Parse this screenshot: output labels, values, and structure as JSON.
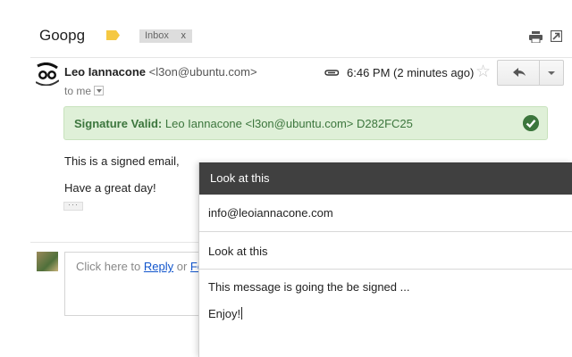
{
  "thread": {
    "subject": "Goopg",
    "label_chip": "Inbox",
    "label_chip_remove": "x"
  },
  "message": {
    "sender_name": "Leo Iannacone",
    "sender_email": "<l3on@ubuntu.com>",
    "recipient_line": "to me",
    "time": "6:46 PM (2 minutes ago)"
  },
  "signature": {
    "label": "Signature Valid:",
    "details": " Leo Iannacone <l3on@ubuntu.com> D282FC25",
    "status_color": "#3c763d",
    "background_color": "#dff0d8"
  },
  "body": {
    "line1": "This is a signed email,",
    "line2": "Have a great day!",
    "trimmed_indicator": "···"
  },
  "reply_box": {
    "prefix": "Click here to ",
    "reply_link": "Reply",
    "separator": " or ",
    "forward_link": "Fo"
  },
  "compose": {
    "header_title": "Look at this",
    "to": "info@leoiannacone.com",
    "subject": "Look at this",
    "body_line1": "This message is going the be signed ...",
    "body_line2": "Enjoy!"
  },
  "icons": {
    "label": "label-tag-icon",
    "print": "print-icon",
    "new_window": "new-window-icon",
    "attachment": "paperclip-icon",
    "star": "star-icon",
    "reply": "reply-arrow-icon",
    "more": "chevron-down-icon",
    "verified": "check-circle-icon"
  },
  "colors": {
    "label_tag": "#f5c842",
    "compose_header": "#404040",
    "link": "#1155cc"
  }
}
